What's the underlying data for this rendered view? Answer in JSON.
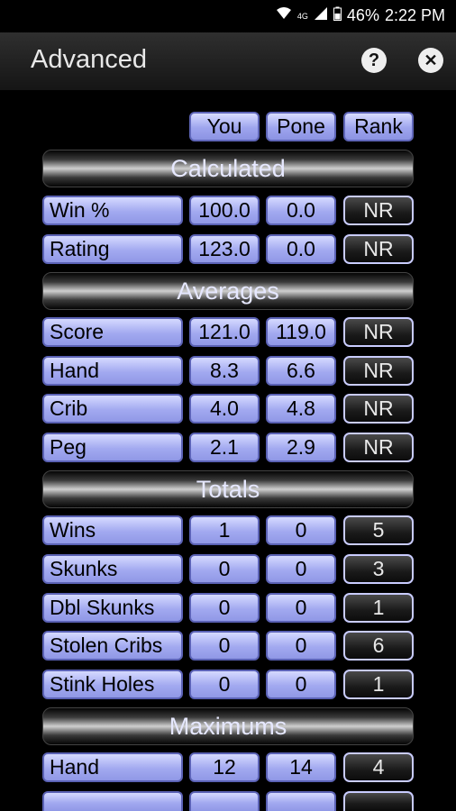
{
  "status": {
    "time": "2:22 PM",
    "battery": "46%",
    "network": "4G"
  },
  "appbar": {
    "title": "Advanced"
  },
  "columns": {
    "you": "You",
    "pone": "Pone",
    "rank": "Rank"
  },
  "sections": {
    "calculated": "Calculated",
    "averages": "Averages",
    "totals": "Totals",
    "maximums": "Maximums"
  },
  "rows": {
    "win_pct": {
      "label": "Win %",
      "you": "100.0",
      "pone": "0.0",
      "rank": "NR"
    },
    "rating": {
      "label": "Rating",
      "you": "123.0",
      "pone": "0.0",
      "rank": "NR"
    },
    "score": {
      "label": "Score",
      "you": "121.0",
      "pone": "119.0",
      "rank": "NR"
    },
    "avg_hand": {
      "label": "Hand",
      "you": "8.3",
      "pone": "6.6",
      "rank": "NR"
    },
    "crib": {
      "label": "Crib",
      "you": "4.0",
      "pone": "4.8",
      "rank": "NR"
    },
    "peg": {
      "label": "Peg",
      "you": "2.1",
      "pone": "2.9",
      "rank": "NR"
    },
    "wins": {
      "label": "Wins",
      "you": "1",
      "pone": "0",
      "rank": "5"
    },
    "skunks": {
      "label": "Skunks",
      "you": "0",
      "pone": "0",
      "rank": "3"
    },
    "dbl_skunks": {
      "label": "Dbl Skunks",
      "you": "0",
      "pone": "0",
      "rank": "1"
    },
    "stolen_cribs": {
      "label": "Stolen Cribs",
      "you": "0",
      "pone": "0",
      "rank": "6"
    },
    "stink_holes": {
      "label": "Stink Holes",
      "you": "0",
      "pone": "0",
      "rank": "1"
    },
    "max_hand": {
      "label": "Hand",
      "you": "12",
      "pone": "14",
      "rank": "4"
    }
  }
}
